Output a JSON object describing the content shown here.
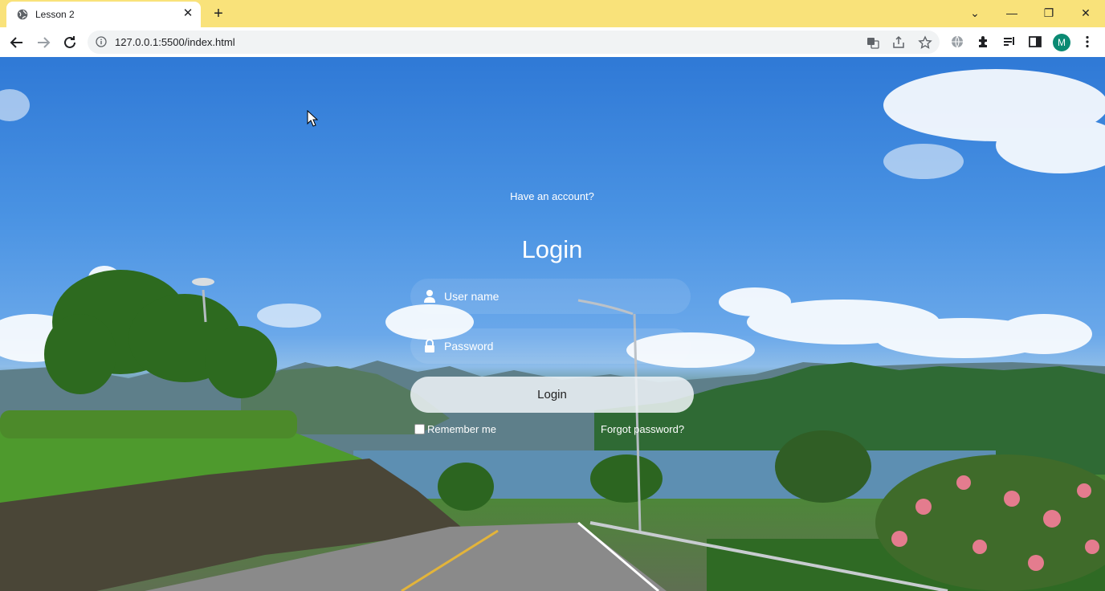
{
  "browser": {
    "tab_title": "Lesson 2",
    "url": "127.0.0.1:5500/index.html",
    "profile_initial": "M"
  },
  "login": {
    "subtitle": "Have an account?",
    "title": "Login",
    "username_placeholder": "User name",
    "password_placeholder": "Password",
    "submit_label": "Login",
    "remember_label": "Remember me",
    "forgot_label": "Forgot password?"
  },
  "colors": {
    "tabstrip": "#f9e27a",
    "avatar": "#0b8a73",
    "button": "#f0f4f8"
  }
}
